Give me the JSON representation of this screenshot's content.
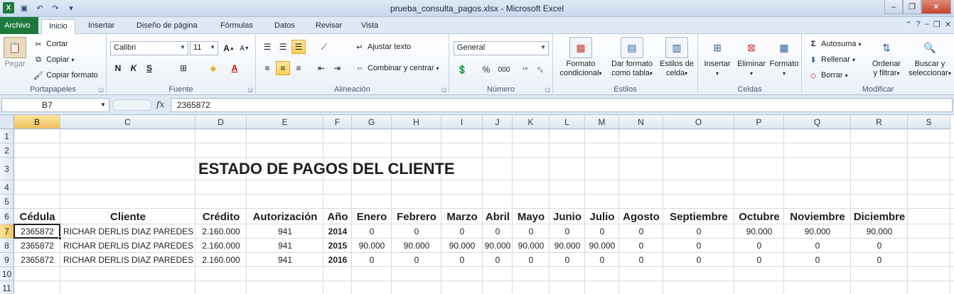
{
  "window": {
    "title": "prueba_consulta_pagos.xlsx  -  Microsoft Excel"
  },
  "qat": {
    "app_icon_letter": "X"
  },
  "tabs": [
    {
      "label": "Archivo"
    },
    {
      "label": "Inicio"
    },
    {
      "label": "Insertar"
    },
    {
      "label": "Diseño de página"
    },
    {
      "label": "Fórmulas"
    },
    {
      "label": "Datos"
    },
    {
      "label": "Revisar"
    },
    {
      "label": "Vista"
    }
  ],
  "ribbon": {
    "clipboard": {
      "label": "Portapapeles",
      "paste": "Pegar",
      "cut": "Cortar",
      "copy": "Copiar",
      "format_painter": "Copiar formato"
    },
    "font": {
      "label": "Fuente",
      "font_name": "Calibri",
      "font_size": "11",
      "bold": "N",
      "italic": "K",
      "underline": "S"
    },
    "alignment": {
      "label": "Alineación",
      "wrap_text": "Ajustar texto",
      "merge_center": "Combinar y centrar"
    },
    "number": {
      "label": "Número",
      "format": "General",
      "percent": "%",
      "thousands": "000"
    },
    "styles": {
      "label": "Estilos",
      "conditional_1": "Formato",
      "conditional_2": "condicional",
      "table_1": "Dar formato",
      "table_2": "como tabla",
      "cell_1": "Estilos de",
      "cell_2": "celda"
    },
    "cells": {
      "label": "Celdas",
      "insert": "Insertar",
      "delete": "Eliminar",
      "format": "Formato"
    },
    "editing": {
      "label": "Modificar",
      "autosum": "Autosuma",
      "fill": "Rellenar",
      "clear": "Borrar",
      "sort_1": "Ordenar",
      "sort_2": "y filtrar",
      "find_1": "Buscar y",
      "find_2": "seleccionar"
    }
  },
  "formula_bar": {
    "name_box": "B7",
    "fx_label": "fx",
    "value": "2365872"
  },
  "sheet": {
    "columns": [
      "B",
      "C",
      "D",
      "E",
      "F",
      "G",
      "H",
      "I",
      "J",
      "K",
      "L",
      "M",
      "N",
      "O",
      "P",
      "Q",
      "R",
      "S"
    ],
    "rows": [
      "1",
      "2",
      "3",
      "4",
      "5",
      "6",
      "7",
      "8",
      "9",
      "10",
      "11"
    ],
    "selected_cell": "B7",
    "title": "ESTADO DE PAGOS DEL CLIENTE",
    "headers": [
      "Cédula",
      "Cliente",
      "Crédito",
      "Autorización",
      "Año",
      "Enero",
      "Febrero",
      "Marzo",
      "Abril",
      "Mayo",
      "Junio",
      "Julio",
      "Agosto",
      "Septiembre",
      "Octubre",
      "Noviembre",
      "Diciembre"
    ],
    "data": [
      [
        "2365872",
        "RICHAR DERLIS DIAZ PAREDES",
        "2.160.000",
        "941",
        "2014",
        "0",
        "0",
        "0",
        "0",
        "0",
        "0",
        "0",
        "0",
        "0",
        "90.000",
        "90.000",
        "90.000"
      ],
      [
        "2365872",
        "RICHAR DERLIS DIAZ PAREDES",
        "2.160.000",
        "941",
        "2015",
        "90.000",
        "90.000",
        "90.000",
        "90.000",
        "90.000",
        "90.000",
        "90.000",
        "0",
        "0",
        "0",
        "0",
        "0"
      ],
      [
        "2365872",
        "RICHAR DERLIS DIAZ PAREDES",
        "2.160.000",
        "941",
        "2016",
        "0",
        "0",
        "0",
        "0",
        "0",
        "0",
        "0",
        "0",
        "0",
        "0",
        "0",
        "0"
      ]
    ]
  }
}
